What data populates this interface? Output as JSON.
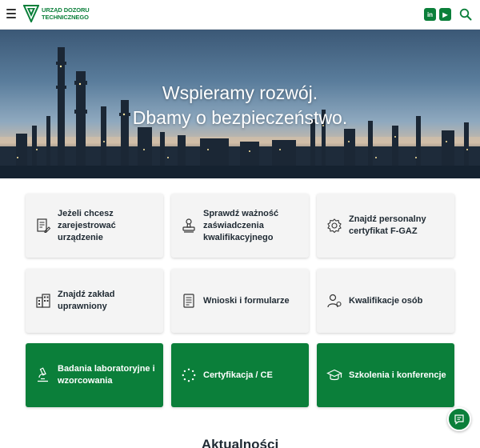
{
  "header": {
    "logo_line1": "URZĄD DOZORU",
    "logo_line2": "TECHNICZNEGO",
    "linkedin_label": "in",
    "youtube_label": "▶",
    "brand_color": "#0b7f3a"
  },
  "hero": {
    "line1": "Wspieramy rozwój.",
    "line2": "Dbamy o bezpieczeństwo."
  },
  "cards": [
    {
      "label": "Jeżeli chcesz zarejestrować urządzenie",
      "icon": "document-edit-icon"
    },
    {
      "label": "Sprawdź ważność zaświadczenia kwalifikacyjnego",
      "icon": "stamp-icon"
    },
    {
      "label": "Znajdź personalny certyfikat F-GAZ",
      "icon": "certificate-badge-icon"
    },
    {
      "label": "Znajdź zakład uprawniony",
      "icon": "building-icon"
    },
    {
      "label": "Wnioski i formularze",
      "icon": "form-icon"
    },
    {
      "label": "Kwalifikacje osób",
      "icon": "person-badge-icon"
    },
    {
      "label": "Badania laboratoryjne i wzorcowania",
      "icon": "microscope-icon"
    },
    {
      "label": "Certyfikacja / CE",
      "icon": "stars-circle-icon"
    },
    {
      "label": "Szkolenia i konferencje",
      "icon": "graduation-cap-icon"
    }
  ],
  "news": {
    "title": "Aktualności"
  }
}
